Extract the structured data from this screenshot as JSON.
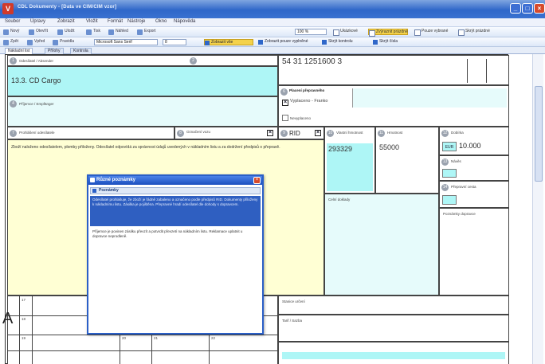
{
  "window": {
    "title": "CDL Dokumenty - [Data ve CIM/CIM vzor]",
    "app_icon": "V",
    "min": "_",
    "max": "□",
    "close": "×"
  },
  "menu": [
    "Soubor",
    "Úpravy",
    "Zobrazit",
    "Vložit",
    "Formát",
    "Nástroje",
    "Okno",
    "Nápověda"
  ],
  "toolbar1": {
    "items": [
      "Nový",
      "Otevřít",
      "Uložit",
      "Tisk",
      "Náhled",
      "Export"
    ],
    "zoom_combo": "100 %",
    "checks": [
      "Ukázkové",
      "Zvýraznit",
      "Pouze vybrané"
    ],
    "highlight_label": "Zvýraznit prázdné",
    "last_label": "Skrýt prázdné"
  },
  "toolbar2": {
    "items": [
      "Zpět",
      "Vpřed",
      "Pravidla"
    ],
    "font_combo": "Microsoft Sans Serif",
    "size_combo": "8",
    "segments": [
      "Zobrazit vše",
      "Zobrazit pouze vyplněné",
      "Skrýt kontrolu",
      "Skrýt čísla"
    ]
  },
  "tabs": [
    "Nákladní list",
    "Přílohy",
    "Kontrola"
  ],
  "document": {
    "field_top_label": "Odesílatel / Absender",
    "doc_number": "54 31 1251600 3",
    "carrier": "13.3. CD Cargo",
    "field_receiver_label": "Příjemce / Empfänger",
    "payment_label": "Placení přepravného",
    "franco_label": "Vyplaceno - Franko",
    "unfranco_label": "Nevyplaceno",
    "wagon_label": "Označení vozu",
    "rid_label": "RID",
    "tare_label": "Vlastní hmotnost",
    "tare_value": "293329",
    "weight_label": "Hmotnost",
    "weight_value": "55000",
    "cash_label": "Dobírka",
    "cash_code": "EUR",
    "cash_value": "10.000",
    "declaration_label": "Prohlášení odesílatele",
    "declaration_text": "Zboží naloženo odesílatelem, plomby přiloženy. Odesílatel odpovídá za správnost údajů uvedených v nákladním listu a za dodržení předpisů o přepravě.",
    "customs_label": "Celní doklady",
    "trailer_label": "Návěs",
    "route_label": "Přepravní cesta",
    "station_label": "Stanice určení",
    "tariff_label": "Tarif / Sazba",
    "remarks_label": "Poznámky dopravce",
    "left_letter": "A",
    "row_codes": [
      "17",
      "18",
      "19",
      "20",
      "21",
      "22"
    ]
  },
  "dialog": {
    "title": "Různé poznámky",
    "close": "×",
    "section": "Poznámky",
    "selected_text": "Odesílatel prohlašuje, že zboží je řádně zabaleno a označeno podle předpisů RID. Dokumenty přiloženy k nákladnímu listu. Zásilka je pojištěna. Přepravné hradí odesílatel dle dohody s dopravcem.",
    "body_text": "Příjemce je povinen zásilku převzít a potvrdit převzetí na nákladním listu. Reklamace uplatnit u dopravce neprodleně."
  }
}
